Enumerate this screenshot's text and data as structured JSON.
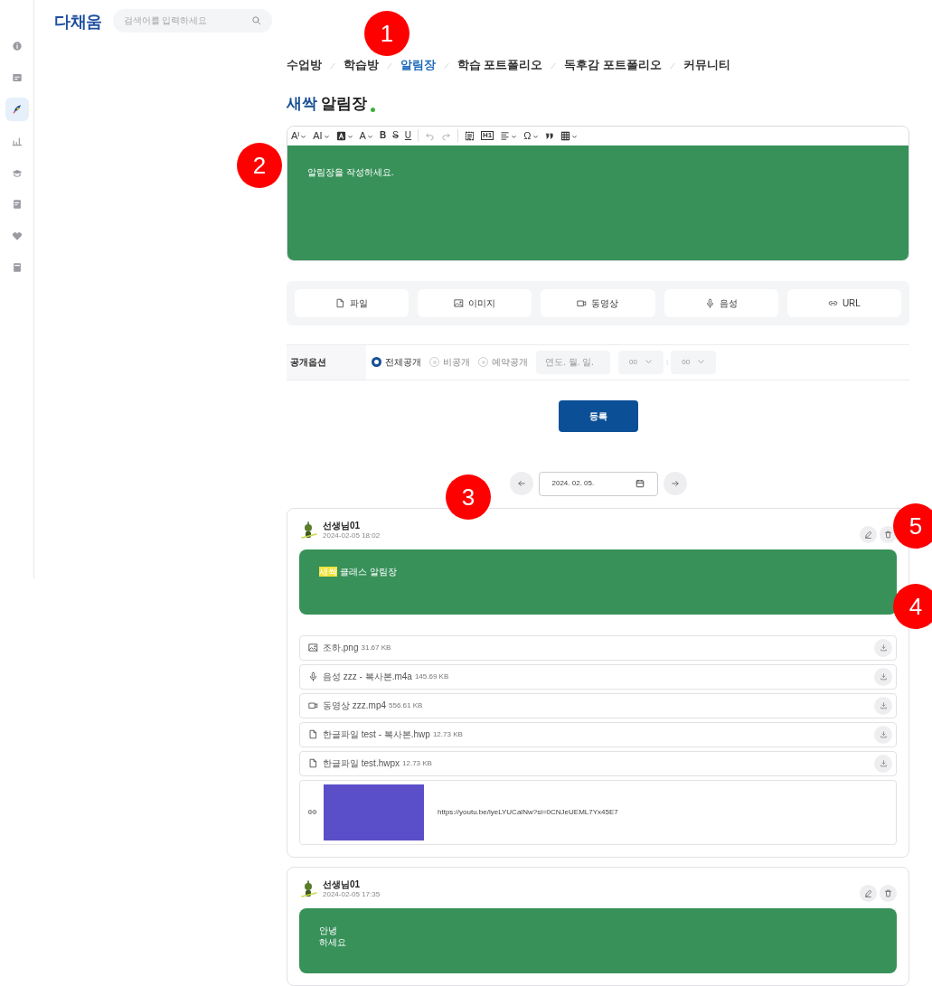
{
  "sidebar": {
    "items": [
      {
        "selected": false
      },
      {
        "selected": false
      },
      {
        "selected": true
      },
      {
        "selected": false
      },
      {
        "selected": false
      },
      {
        "selected": false
      },
      {
        "selected": false
      },
      {
        "selected": false
      }
    ]
  },
  "logo": {
    "text": "다채움"
  },
  "search": {
    "placeholder": "검색어를 입력하세요"
  },
  "breadcrumb": [
    {
      "label": "수업방",
      "selected": false
    },
    {
      "label": "학습방",
      "selected": false
    },
    {
      "label": "알림장",
      "selected": true
    },
    {
      "label": "학습 포트폴리오",
      "selected": false
    },
    {
      "label": "독후감 포트폴리오",
      "selected": false
    },
    {
      "label": "커뮤니티",
      "selected": false
    }
  ],
  "title": {
    "accent": "새싹",
    "text": "알림장"
  },
  "editor": {
    "toolbar": [
      {
        "kind": "text",
        "label": "Aᴵ",
        "dropdown": true
      },
      {
        "kind": "text",
        "label": "AI",
        "dropdown": true
      },
      {
        "kind": "bg-color",
        "dropdown": true
      },
      {
        "kind": "text",
        "label": "A",
        "dropdown": true
      },
      {
        "kind": "bold",
        "label": "B",
        "dropdown": false
      },
      {
        "kind": "strike",
        "label": "S",
        "dropdown": false
      },
      {
        "kind": "underline",
        "label": "U",
        "dropdown": false
      },
      {
        "kind": "divider"
      },
      {
        "kind": "undo",
        "dropdown": false
      },
      {
        "kind": "redo",
        "dropdown": false
      },
      {
        "kind": "divider"
      },
      {
        "kind": "select-all",
        "dropdown": false
      },
      {
        "kind": "boxed",
        "label": "H1",
        "dropdown": false
      },
      {
        "kind": "align",
        "dropdown": true
      },
      {
        "kind": "text",
        "label": "Ω",
        "dropdown": true
      },
      {
        "kind": "quote",
        "dropdown": false
      },
      {
        "kind": "table",
        "dropdown": true
      }
    ],
    "placeholder": "알림장을 작성하세요."
  },
  "attach_buttons": [
    {
      "kind": "file",
      "label": "파일"
    },
    {
      "kind": "image",
      "label": "이미지"
    },
    {
      "kind": "video",
      "label": "동영상"
    },
    {
      "kind": "audio",
      "label": "음성"
    },
    {
      "kind": "link",
      "label": "URL"
    }
  ],
  "visibility": {
    "label": "공개옵션",
    "options": [
      {
        "label": "전체공개",
        "selected": true
      },
      {
        "label": "비공개",
        "selected": false
      },
      {
        "label": "예약공개",
        "selected": false
      }
    ],
    "date_placeholder": "연도. 월. 일.",
    "hour": "00",
    "separator": ":",
    "minute": "00"
  },
  "submit": "등록",
  "date_nav": {
    "date": "2024. 02. 05."
  },
  "posts": [
    {
      "author": "선생님01",
      "time": "2024-02-05 18:02",
      "content": [
        [
          {
            "text": "새싹",
            "highlighted": true
          },
          {
            "text": " 클래스 알림장",
            "highlighted": false
          }
        ]
      ],
      "attachments": [
        {
          "kind": "image",
          "name": "조하.png",
          "size": "31.67 KB"
        },
        {
          "kind": "audio",
          "name": "음성 zzz - 복사본.m4a",
          "size": "145.69 KB"
        },
        {
          "kind": "video",
          "name": "동영상 zzz.mp4",
          "size": "556.61 KB"
        },
        {
          "kind": "file",
          "name": "한글파일 test - 복사본.hwp",
          "size": "12.73 KB"
        },
        {
          "kind": "file",
          "name": "한글파일 test.hwpx",
          "size": "12.73 KB"
        },
        {
          "kind": "link",
          "url": "https://youtu.be/lyeLYUCalNw?si=0CNJeUEML7Yx45E7"
        }
      ]
    },
    {
      "author": "선생님01",
      "time": "2024-02-05 17:35",
      "content": [
        [
          {
            "text": "안녕",
            "highlighted": false
          }
        ],
        [
          {
            "text": "하세요",
            "highlighted": false
          }
        ]
      ]
    }
  ],
  "markers": [
    {
      "label": "1"
    },
    {
      "label": "2"
    },
    {
      "label": "3"
    },
    {
      "label": "5"
    },
    {
      "label": "4"
    }
  ]
}
